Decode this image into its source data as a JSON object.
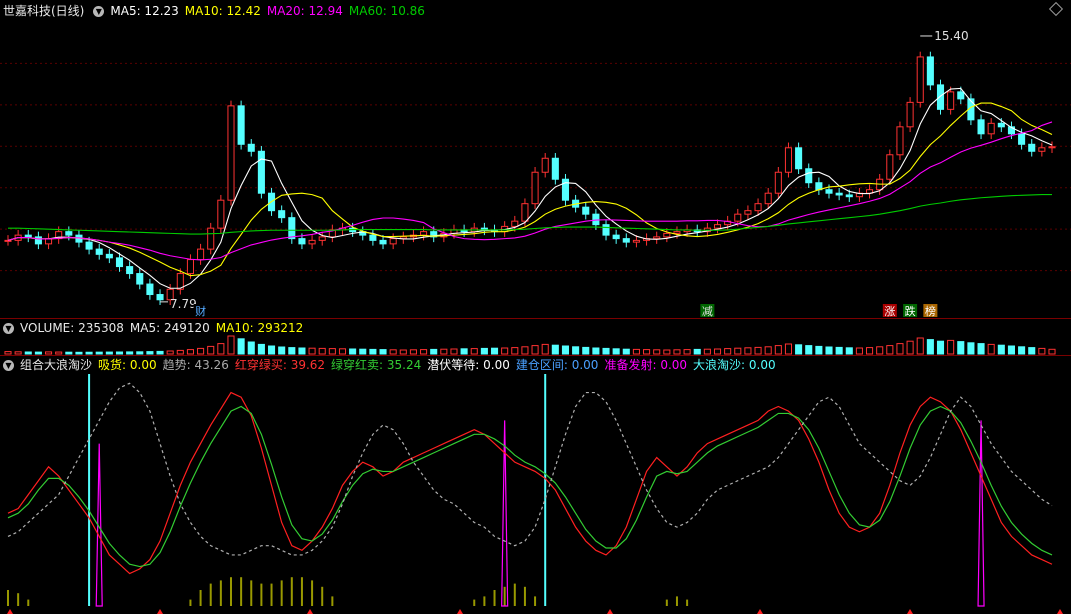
{
  "price_panel": {
    "title": "世嘉科技(日线)",
    "ma5_label": "MA5: 12.23",
    "ma10_label": "MA10: 12.42",
    "ma20_label": "MA20: 12.94",
    "ma60_label": "MA60: 10.86",
    "high_label": "15.40",
    "low_label": "7.79",
    "markers": [
      "财",
      "减",
      "涨",
      "跌",
      "榜"
    ],
    "colors": {
      "ma5": "#ffffff",
      "ma10": "#ffff00",
      "ma20": "#ff00ff",
      "ma60": "#00cc00",
      "up": "#ff3232",
      "down": "#54ffff"
    }
  },
  "volume_panel": {
    "volume_label": "VOLUME: 235308",
    "ma5_label": "MA5: 249120",
    "ma10_label": "MA10: 293212"
  },
  "indicator_panel": {
    "title": "组合大浪淘沙",
    "items": [
      {
        "name": "吸货:",
        "value": "0.00",
        "name_color": "#ffff00",
        "value_color": "#ffff00"
      },
      {
        "name": "趋势:",
        "value": "43.26",
        "name_color": "#aaaaaa",
        "value_color": "#aaaaaa"
      },
      {
        "name": "红穿绿买:",
        "value": "39.62",
        "name_color": "#ff3232",
        "value_color": "#ff3232"
      },
      {
        "name": "绿穿红卖:",
        "value": "35.24",
        "name_color": "#33cc33",
        "value_color": "#33cc33"
      },
      {
        "name": "潜伏等待:",
        "value": "0.00",
        "name_color": "#ffffff",
        "value_color": "#ffffff"
      },
      {
        "name": "建仓区间:",
        "value": "0.00",
        "name_color": "#4aa0ff",
        "value_color": "#4aa0ff"
      },
      {
        "name": "准备发射:",
        "value": "0.00",
        "name_color": "#ff00ff",
        "value_color": "#ff00ff"
      },
      {
        "name": "大浪淘沙:",
        "value": "0.00",
        "name_color": "#54ffff",
        "value_color": "#54ffff"
      }
    ]
  },
  "chart_data": [
    {
      "type": "candlestick",
      "title": "世嘉科技(日线)",
      "ylim": [
        7.5,
        15.8
      ],
      "annotations": {
        "high": 15.4,
        "low": 7.79
      },
      "ma_legend": {
        "MA5": 12.23,
        "MA10": 12.42,
        "MA20": 12.94,
        "MA60": 10.86
      },
      "close": [
        9.55,
        9.7,
        9.65,
        9.45,
        9.6,
        9.8,
        9.7,
        9.5,
        9.3,
        9.15,
        9.05,
        8.8,
        8.6,
        8.3,
        8.0,
        7.85,
        8.15,
        8.6,
        9.0,
        9.3,
        9.9,
        10.7,
        13.4,
        12.3,
        12.1,
        10.9,
        10.4,
        10.2,
        9.6,
        9.45,
        9.55,
        9.65,
        9.85,
        9.9,
        9.8,
        9.7,
        9.55,
        9.45,
        9.6,
        9.65,
        9.7,
        9.8,
        9.65,
        9.75,
        9.85,
        9.8,
        9.9,
        9.85,
        9.8,
        9.95,
        10.1,
        10.6,
        11.5,
        11.9,
        11.3,
        10.7,
        10.5,
        10.3,
        10.0,
        9.7,
        9.6,
        9.5,
        9.55,
        9.6,
        9.65,
        9.75,
        9.8,
        9.85,
        9.8,
        9.9,
        10.0,
        10.1,
        10.3,
        10.4,
        10.6,
        10.9,
        11.5,
        12.2,
        11.6,
        11.2,
        11.0,
        10.9,
        10.85,
        10.8,
        10.9,
        11.0,
        11.3,
        12.0,
        12.8,
        13.5,
        14.8,
        14.0,
        13.3,
        13.8,
        13.6,
        13.0,
        12.6,
        12.9,
        12.8,
        12.6,
        12.3,
        12.1,
        12.2,
        12.23
      ],
      "ma_series": {
        "MA5": [
          9.55,
          9.63,
          9.63,
          9.59,
          9.59,
          9.64,
          9.64,
          9.61,
          9.58,
          9.49,
          9.34,
          9.16,
          8.98,
          8.76,
          8.55,
          8.31,
          8.18,
          8.18,
          8.32,
          8.58,
          8.99,
          9.5,
          10.46,
          11.12,
          11.68,
          11.88,
          11.82,
          11.18,
          10.64,
          10.11,
          9.84,
          9.69,
          9.63,
          9.69,
          9.75,
          9.79,
          9.75,
          9.66,
          9.62,
          9.59,
          9.59,
          9.64,
          9.68,
          9.71,
          9.75,
          9.77,
          9.79,
          9.83,
          9.84,
          9.86,
          9.92,
          10.06,
          10.39,
          10.81,
          11.08,
          11.2,
          11.18,
          10.94,
          10.56,
          10.24,
          10.02,
          9.82,
          9.67,
          9.59,
          9.58,
          9.61,
          9.67,
          9.73,
          9.77,
          9.82,
          9.87,
          9.93,
          10.02,
          10.14,
          10.28,
          10.46,
          10.74,
          11.12,
          11.36,
          11.48,
          11.5,
          11.38,
          11.11,
          10.95,
          10.89,
          10.89,
          10.97,
          11.2,
          11.6,
          12.12,
          12.88,
          13.42,
          13.68,
          13.88,
          13.9,
          13.54,
          13.26,
          13.18,
          12.98,
          12.78,
          12.64,
          12.54,
          12.4,
          12.28
        ],
        "MA10": [
          9.55,
          9.63,
          9.63,
          9.59,
          9.59,
          9.61,
          9.63,
          9.62,
          9.59,
          9.55,
          9.5,
          9.42,
          9.33,
          9.21,
          9.07,
          8.93,
          8.78,
          8.67,
          8.54,
          8.57,
          8.67,
          8.84,
          9.32,
          9.72,
          10.13,
          10.44,
          10.66,
          10.84,
          10.88,
          10.9,
          10.86,
          10.76,
          10.4,
          10.16,
          9.93,
          9.81,
          9.73,
          9.66,
          9.66,
          9.67,
          9.68,
          9.69,
          9.67,
          9.68,
          9.7,
          9.72,
          9.74,
          9.78,
          9.8,
          9.8,
          9.85,
          9.93,
          10.09,
          10.3,
          10.44,
          10.53,
          10.59,
          10.64,
          10.66,
          10.64,
          10.59,
          10.47,
          10.28,
          10.05,
          9.89,
          9.79,
          9.72,
          9.68,
          9.66,
          9.68,
          9.72,
          9.78,
          9.85,
          9.93,
          10.03,
          10.17,
          10.34,
          10.58,
          10.77,
          10.9,
          11.0,
          11.08,
          11.1,
          11.14,
          11.17,
          11.18,
          11.16,
          11.16,
          11.32,
          11.56,
          11.95,
          12.29,
          12.54,
          12.84,
          13.11,
          13.36,
          13.48,
          13.48,
          13.38,
          13.26,
          13.01,
          12.84,
          12.72,
          12.58
        ],
        "MA20": [
          9.55,
          9.63,
          9.63,
          9.59,
          9.59,
          9.61,
          9.63,
          9.62,
          9.59,
          9.55,
          9.5,
          9.46,
          9.41,
          9.34,
          9.27,
          9.18,
          9.11,
          9.06,
          9.01,
          8.99,
          9.01,
          9.06,
          9.2,
          9.31,
          9.42,
          9.49,
          9.56,
          9.61,
          9.65,
          9.68,
          9.72,
          9.78,
          9.82,
          9.9,
          9.98,
          10.07,
          10.15,
          10.19,
          10.19,
          10.16,
          10.12,
          10.06,
          9.88,
          9.77,
          9.66,
          9.6,
          9.58,
          9.57,
          9.58,
          9.6,
          9.62,
          9.67,
          9.76,
          9.87,
          9.95,
          10.0,
          10.05,
          10.1,
          10.13,
          10.14,
          10.13,
          10.12,
          10.11,
          10.1,
          10.1,
          10.1,
          10.1,
          10.11,
          10.11,
          10.12,
          10.12,
          10.09,
          10.03,
          9.97,
          9.94,
          9.95,
          10.02,
          10.13,
          10.21,
          10.29,
          10.36,
          10.42,
          10.48,
          10.54,
          10.6,
          10.67,
          10.75,
          10.87,
          11.05,
          11.23,
          11.47,
          11.65,
          11.77,
          11.93,
          12.08,
          12.19,
          12.27,
          12.36,
          12.46,
          12.55,
          12.62,
          12.69,
          12.84,
          12.94
        ],
        "MA60": [
          9.9,
          9.9,
          9.89,
          9.88,
          9.87,
          9.86,
          9.85,
          9.84,
          9.83,
          9.82,
          9.81,
          9.8,
          9.79,
          9.78,
          9.77,
          9.76,
          9.75,
          9.74,
          9.73,
          9.73,
          9.74,
          9.75,
          9.78,
          9.8,
          9.82,
          9.83,
          9.84,
          9.84,
          9.84,
          9.84,
          9.84,
          9.84,
          9.84,
          9.85,
          9.86,
          9.86,
          9.86,
          9.86,
          9.86,
          9.86,
          9.86,
          9.86,
          9.85,
          9.85,
          9.85,
          9.85,
          9.85,
          9.85,
          9.85,
          9.85,
          9.86,
          9.87,
          9.89,
          9.91,
          9.92,
          9.93,
          9.93,
          9.93,
          9.93,
          9.92,
          9.91,
          9.9,
          9.89,
          9.88,
          9.87,
          9.86,
          9.85,
          9.85,
          9.84,
          9.84,
          9.84,
          9.85,
          9.87,
          9.9,
          9.92,
          9.95,
          9.98,
          10.02,
          10.05,
          10.08,
          10.11,
          10.14,
          10.17,
          10.2,
          10.23,
          10.26,
          10.3,
          10.35,
          10.4,
          10.46,
          10.53,
          10.58,
          10.62,
          10.67,
          10.71,
          10.74,
          10.77,
          10.79,
          10.81,
          10.83,
          10.84,
          10.85,
          10.86,
          10.86
        ]
      }
    },
    {
      "type": "bar",
      "title": "VOLUME",
      "legend": {
        "VOLUME": 235308,
        "MA5": 249120,
        "MA10": 293212
      },
      "values": [
        120000,
        110000,
        100000,
        95000,
        105000,
        98000,
        90000,
        85000,
        88000,
        92000,
        96000,
        100000,
        105000,
        110000,
        120000,
        130000,
        150000,
        180000,
        220000,
        280000,
        380000,
        520000,
        900000,
        760000,
        600000,
        480000,
        400000,
        350000,
        320000,
        300000,
        290000,
        280000,
        270000,
        260000,
        250000,
        240000,
        230000,
        220000,
        210000,
        200000,
        210000,
        220000,
        230000,
        240000,
        250000,
        260000,
        270000,
        280000,
        290000,
        300000,
        320000,
        360000,
        420000,
        480000,
        440000,
        400000,
        360000,
        330000,
        300000,
        280000,
        260000,
        240000,
        230000,
        220000,
        210000,
        200000,
        210000,
        220000,
        230000,
        240000,
        250000,
        270000,
        290000,
        310000,
        330000,
        360000,
        420000,
        500000,
        460000,
        420000,
        380000,
        350000,
        330000,
        310000,
        300000,
        320000,
        360000,
        420000,
        520000,
        640000,
        800000,
        720000,
        640000,
        680000,
        620000,
        560000,
        520000,
        480000,
        440000,
        400000,
        360000,
        320000,
        280000,
        235308
      ]
    },
    {
      "type": "line",
      "title": "组合大浪淘沙",
      "ylim": [
        0,
        100
      ],
      "series": [
        {
          "name": "红穿绿买",
          "values": [
            40,
            42,
            48,
            54,
            60,
            56,
            50,
            44,
            38,
            30,
            22,
            18,
            14,
            16,
            20,
            28,
            40,
            52,
            62,
            70,
            78,
            85,
            92,
            90,
            82,
            68,
            52,
            36,
            26,
            24,
            28,
            34,
            42,
            52,
            58,
            62,
            60,
            56,
            58,
            62,
            64,
            66,
            68,
            70,
            72,
            74,
            76,
            74,
            70,
            66,
            62,
            60,
            58,
            55,
            50,
            42,
            34,
            28,
            24,
            22,
            26,
            34,
            46,
            58,
            64,
            60,
            56,
            60,
            66,
            70,
            72,
            74,
            76,
            78,
            80,
            84,
            86,
            84,
            80,
            72,
            62,
            50,
            40,
            34,
            32,
            34,
            40,
            52,
            66,
            78,
            86,
            90,
            88,
            84,
            76,
            66,
            56,
            46,
            36,
            30,
            26,
            22,
            20,
            18
          ]
        },
        {
          "name": "绿穿红卖",
          "values": [
            38,
            40,
            44,
            50,
            55,
            55,
            52,
            47,
            41,
            34,
            27,
            22,
            18,
            17,
            18,
            23,
            32,
            43,
            53,
            62,
            70,
            77,
            84,
            86,
            83,
            74,
            61,
            47,
            35,
            29,
            28,
            31,
            37,
            45,
            52,
            57,
            59,
            58,
            58,
            60,
            62,
            64,
            66,
            68,
            70,
            72,
            74,
            74,
            72,
            69,
            65,
            62,
            60,
            57,
            53,
            47,
            40,
            33,
            28,
            25,
            25,
            29,
            37,
            47,
            56,
            58,
            57,
            58,
            62,
            66,
            69,
            71,
            73,
            75,
            77,
            80,
            83,
            83,
            81,
            76,
            68,
            58,
            48,
            40,
            35,
            34,
            37,
            45,
            56,
            68,
            78,
            84,
            86,
            84,
            79,
            71,
            62,
            52,
            43,
            36,
            31,
            27,
            24,
            22
          ]
        },
        {
          "name": "趋势",
          "values": [
            30,
            32,
            36,
            40,
            44,
            48,
            56,
            64,
            72,
            80,
            88,
            94,
            96,
            92,
            84,
            70,
            56,
            44,
            36,
            30,
            26,
            24,
            22,
            22,
            24,
            26,
            26,
            24,
            22,
            22,
            24,
            28,
            34,
            44,
            56,
            66,
            74,
            78,
            76,
            70,
            62,
            56,
            50,
            46,
            44,
            40,
            36,
            34,
            30,
            28,
            26,
            28,
            34,
            46,
            60,
            74,
            86,
            92,
            92,
            88,
            80,
            70,
            60,
            50,
            42,
            36,
            34,
            36,
            40,
            46,
            50,
            52,
            54,
            56,
            58,
            60,
            64,
            70,
            76,
            82,
            88,
            90,
            86,
            78,
            70,
            66,
            62,
            58,
            54,
            52,
            56,
            64,
            74,
            84,
            90,
            86,
            78,
            70,
            64,
            58,
            54,
            50,
            46,
            43.26
          ]
        }
      ],
      "spikes": {
        "大浪淘沙": [
          {
            "index": 8,
            "value": 100
          },
          {
            "index": 53,
            "value": 100
          }
        ],
        "准备发射": [
          {
            "index": 9,
            "value": 70
          },
          {
            "index": 49,
            "value": 80
          },
          {
            "index": 96,
            "value": 80
          }
        ]
      },
      "legend": {
        "吸货": 0.0,
        "趋势": 43.26,
        "红穿绿买": 39.62,
        "绿穿红卖": 35.24,
        "潜伏等待": 0.0,
        "建仓区间": 0.0,
        "准备发射": 0.0,
        "大浪淘沙": 0.0
      }
    }
  ]
}
